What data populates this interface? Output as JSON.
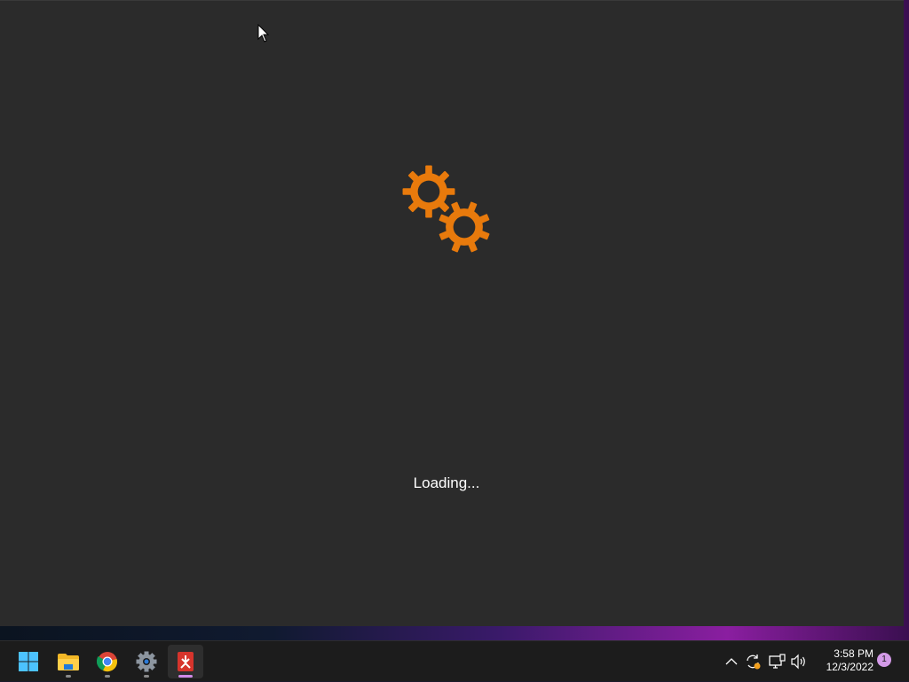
{
  "app": {
    "loading_text": "Loading...",
    "accent_color": "#e87a0c"
  },
  "taskbar": {
    "pinned": [
      {
        "name": "start",
        "icon": "windows-logo-icon",
        "running": false,
        "active": false
      },
      {
        "name": "file-explorer",
        "icon": "folder-icon",
        "running": true,
        "active": false
      },
      {
        "name": "chrome",
        "icon": "chrome-icon",
        "running": true,
        "active": false
      },
      {
        "name": "settings",
        "icon": "gear-icon",
        "running": true,
        "active": false
      },
      {
        "name": "app",
        "icon": "app-installer-icon",
        "running": true,
        "active": true
      }
    ],
    "tray_icons": [
      "chevron-up-icon",
      "sync-icon",
      "network-icon",
      "volume-icon"
    ],
    "time": "3:58 PM",
    "date": "12/3/2022",
    "notification_count": "1"
  }
}
